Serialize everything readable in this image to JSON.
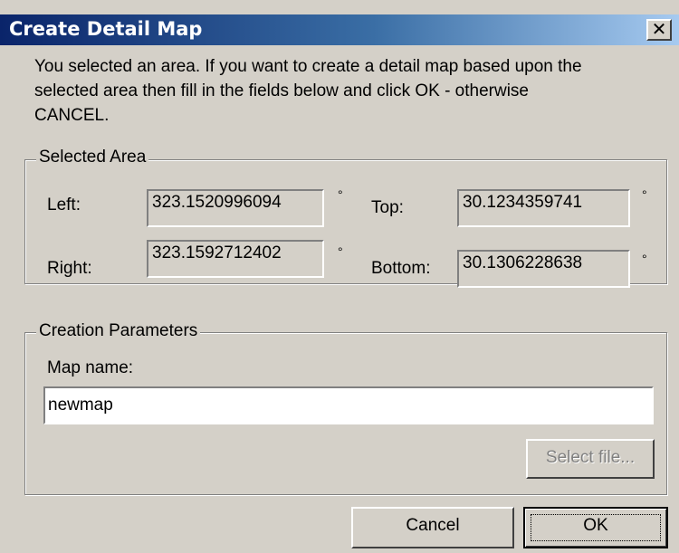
{
  "dialog": {
    "title": "Create Detail Map",
    "close_glyph": "✕",
    "intro_lines": [
      "You selected an area. If you want to create a detail map based upon the",
      "selected area then fill in the fields below and click OK - otherwise",
      "CANCEL."
    ]
  },
  "selected_area": {
    "legend": "Selected Area",
    "left_label": "Left:",
    "left_value": "323.1520996094",
    "right_label": "Right:",
    "right_value": "323.1592712402",
    "top_label": "Top:",
    "top_value": "30.1234359741",
    "bottom_label": "Bottom:",
    "bottom_value": "30.1306228638",
    "degree_symbol": "°"
  },
  "creation_parameters": {
    "legend": "Creation Parameters",
    "map_name_label": "Map name:",
    "map_name_value": "newmap",
    "select_file_label": "Select file..."
  },
  "buttons": {
    "cancel_label": "Cancel",
    "ok_label": "OK"
  }
}
